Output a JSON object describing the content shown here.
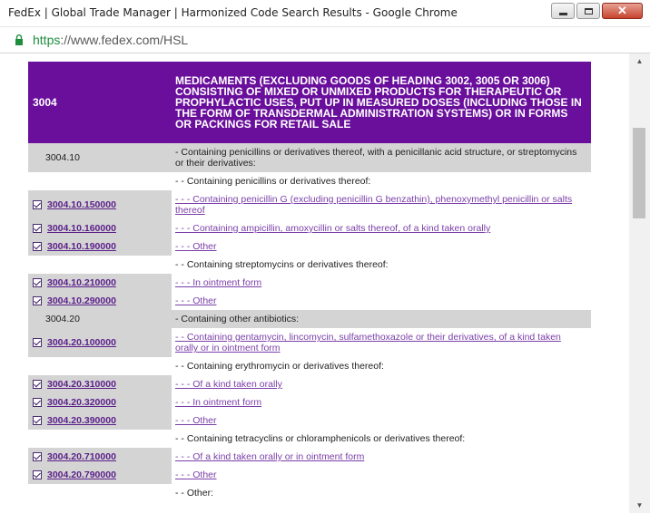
{
  "window": {
    "title": "FedEx | Global Trade Manager | Harmonized Code Search Results - Google Chrome",
    "url_scheme": "https",
    "url_rest": "://www.fedex.com/HSL"
  },
  "table": {
    "heading_code": "3004",
    "heading_desc": "MEDICAMENTS (EXCLUDING GOODS OF HEADING 3002, 3005 OR 3006) CONSISTING OF MIXED OR UNMIXED PRODUCTS FOR THERAPEUTIC OR PROPHYLACTIC USES, PUT UP IN MEASURED DOSES (INCLUDING THOSE IN THE FORM OF TRANSDERMAL ADMINISTRATION SYSTEMS) OR IN FORMS OR PACKINGS FOR RETAIL SALE",
    "rows": [
      {
        "kind": "sub",
        "code": "3004.10",
        "desc": "- Containing penicillins or derivatives thereof, with a penicillanic acid structure, or streptomycins or their derivatives:"
      },
      {
        "kind": "plain",
        "code": "",
        "desc": "- - Containing penicillins or derivatives thereof:"
      },
      {
        "kind": "item",
        "code": "3004.10.150000",
        "desc": "- - - Containing penicillin G (excluding penicillin G benzathin), phenoxymethyl penicillin or salts thereof"
      },
      {
        "kind": "item",
        "code": "3004.10.160000",
        "desc": "- - - Containing ampicillin, amoxycillin or salts thereof, of a kind taken orally"
      },
      {
        "kind": "item",
        "code": "3004.10.190000",
        "desc": "- - - Other"
      },
      {
        "kind": "plain",
        "code": "",
        "desc": "- - Containing streptomycins or derivatives thereof:"
      },
      {
        "kind": "item",
        "code": "3004.10.210000",
        "desc": "- - - In ointment form"
      },
      {
        "kind": "item",
        "code": "3004.10.290000",
        "desc": "- - - Other"
      },
      {
        "kind": "sub",
        "code": "3004.20",
        "desc": "- Containing other antibiotics:"
      },
      {
        "kind": "item",
        "code": "3004.20.100000",
        "desc": "- - Containing gentamycin, lincomycin, sulfamethoxazole or their derivatives, of a kind taken orally or in ointment form"
      },
      {
        "kind": "plain",
        "code": "",
        "desc": "- - Containing erythromycin or derivatives thereof:"
      },
      {
        "kind": "item",
        "code": "3004.20.310000",
        "desc": "- - - Of a kind taken orally"
      },
      {
        "kind": "item",
        "code": "3004.20.320000",
        "desc": "- - - In ointment form"
      },
      {
        "kind": "item",
        "code": "3004.20.390000",
        "desc": "- - - Other"
      },
      {
        "kind": "plain",
        "code": "",
        "desc": "- - Containing tetracyclins or chloramphenicols or derivatives thereof:"
      },
      {
        "kind": "item",
        "code": "3004.20.710000",
        "desc": "- - - Of a kind taken orally or in ointment form"
      },
      {
        "kind": "item",
        "code": "3004.20.790000",
        "desc": "- - - Other"
      },
      {
        "kind": "plain",
        "code": "",
        "desc": "- - Other:"
      }
    ]
  },
  "colors": {
    "header_bg": "#6a0f9c",
    "link": "#5b1f8a",
    "row_gray": "#d4d4d4"
  }
}
